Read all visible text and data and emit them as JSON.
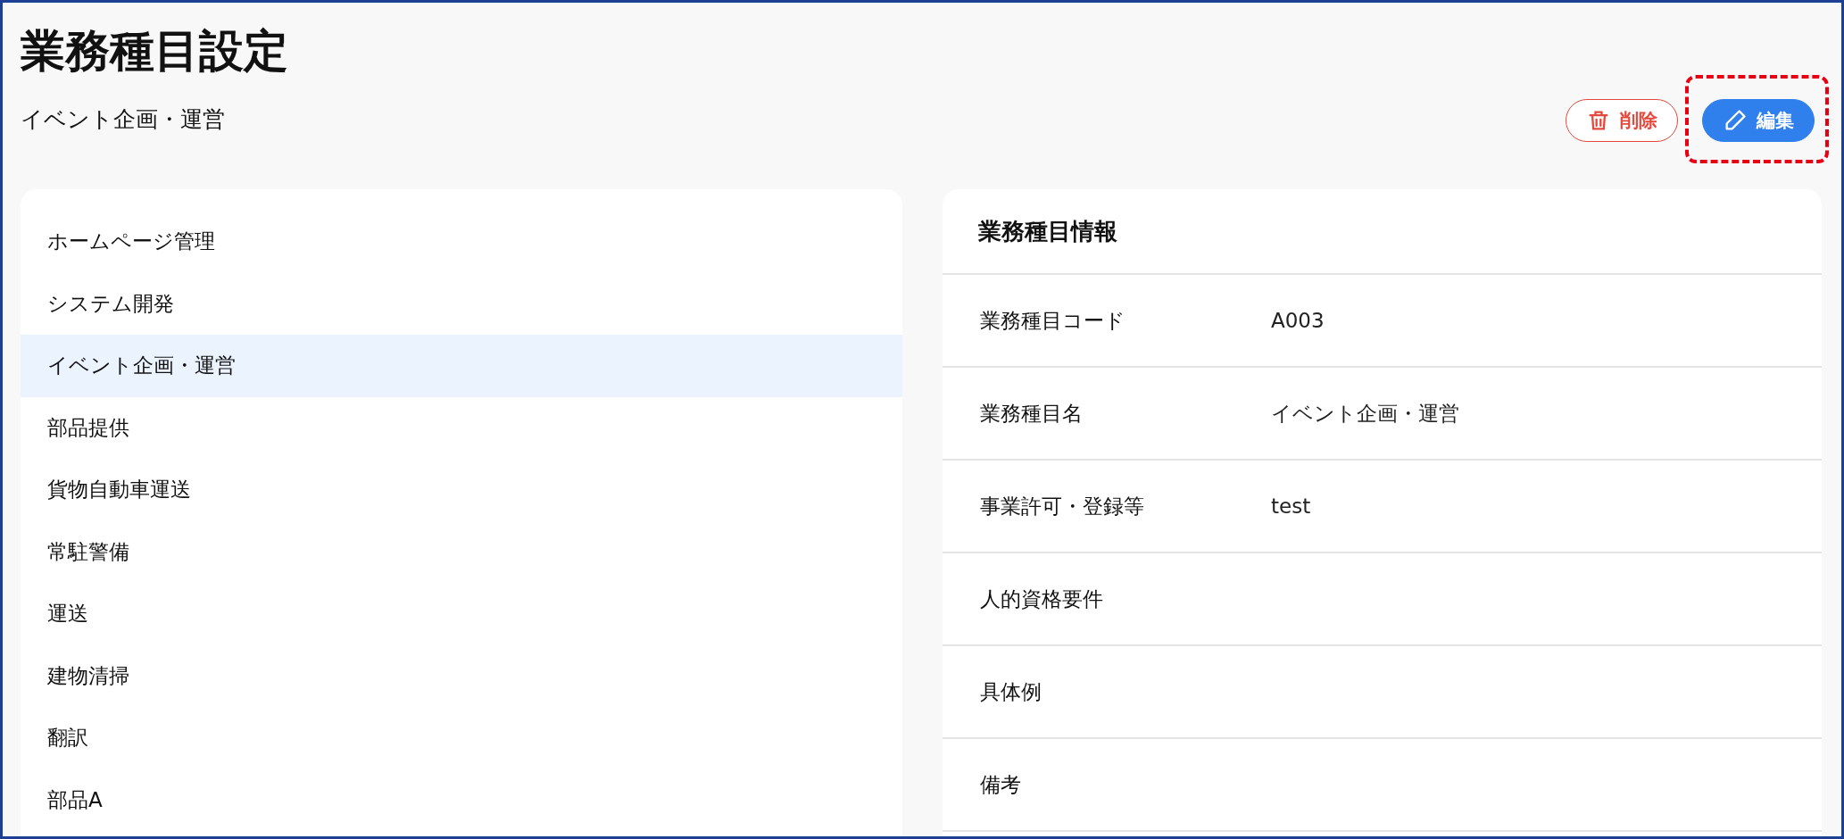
{
  "page": {
    "title": "業務種目設定",
    "subtitle": "イベント企画・運営"
  },
  "actions": [
    {
      "kind": "delete",
      "label": "削除",
      "highlighted": false
    },
    {
      "kind": "edit",
      "label": "編集",
      "highlighted": true
    }
  ],
  "list": {
    "items": [
      {
        "label": "ホームページ管理",
        "selected": false
      },
      {
        "label": "システム開発",
        "selected": false
      },
      {
        "label": "イベント企画・運営",
        "selected": true
      },
      {
        "label": "部品提供",
        "selected": false
      },
      {
        "label": "貨物自動車運送",
        "selected": false
      },
      {
        "label": "常駐警備",
        "selected": false
      },
      {
        "label": "運送",
        "selected": false
      },
      {
        "label": "建物清掃",
        "selected": false
      },
      {
        "label": "翻訳",
        "selected": false
      },
      {
        "label": "部品A",
        "selected": false
      }
    ]
  },
  "detail": {
    "heading": "業務種目情報",
    "fields": [
      {
        "label": "業務種目コード",
        "value": "A003"
      },
      {
        "label": "業務種目名",
        "value": "イベント企画・運営"
      },
      {
        "label": "事業許可・登録等",
        "value": "test"
      },
      {
        "label": "人的資格要件"
      },
      {
        "label": "具体例"
      },
      {
        "label": "備考"
      }
    ]
  }
}
